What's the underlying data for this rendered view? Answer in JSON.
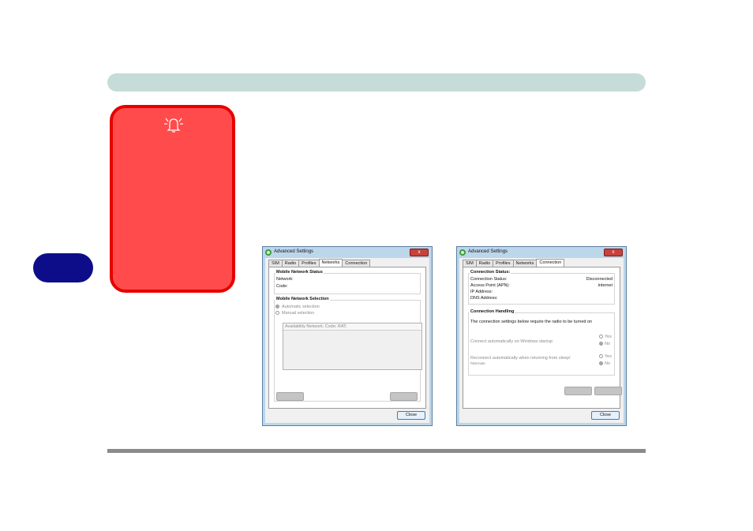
{
  "page": {
    "warning_icon": "bell-alert-icon",
    "colors": {
      "header_bar": "#c5dcd8",
      "warning_fill": "#ff4b4b",
      "warning_border": "#e60000",
      "chapter_tab": "#0d0d8a"
    }
  },
  "dialog_networks": {
    "title": "Advanced Settings",
    "close_glyph": "x",
    "tabs": [
      {
        "label": "SIM"
      },
      {
        "label": "Radio"
      },
      {
        "label": "Profiles"
      },
      {
        "label": "Networks"
      },
      {
        "label": "Connection"
      }
    ],
    "active_tab": "Networks",
    "status_group": {
      "title": "Mobile Network Status",
      "network_label": "Network:",
      "code_label": "Code:"
    },
    "selection_group": {
      "title": "Mobile Network Selection",
      "automatic_label": "Automatic selection",
      "manual_label": "Manual selection",
      "list_header": "Availability Network; Code; RAT;"
    },
    "close_button": "Close"
  },
  "dialog_connection": {
    "title": "Advanced Settings",
    "close_glyph": "x",
    "tabs": [
      {
        "label": "SIM"
      },
      {
        "label": "Radio"
      },
      {
        "label": "Profiles"
      },
      {
        "label": "Networks"
      },
      {
        "label": "Connection"
      }
    ],
    "active_tab": "Connection",
    "status_group": {
      "title": "Connection Status:",
      "connection_status_label": "Connection Status:",
      "connection_status_value": "Disconnected",
      "apn_label": "Access Point (APN):",
      "apn_value": "internet",
      "ip_label": "IP Address:",
      "dns_label": "DNS Address:"
    },
    "handling_group": {
      "title": "Connection Handling",
      "note": "The connection settings below require the radio to be turned on",
      "startup_label": "Connect automatically on Windows startup",
      "resume_label_1": "Reconnect automatically when returning from sleep/",
      "resume_label_2": "hibernate",
      "yes_label": "Yes",
      "no_label": "No"
    },
    "close_button": "Close"
  }
}
